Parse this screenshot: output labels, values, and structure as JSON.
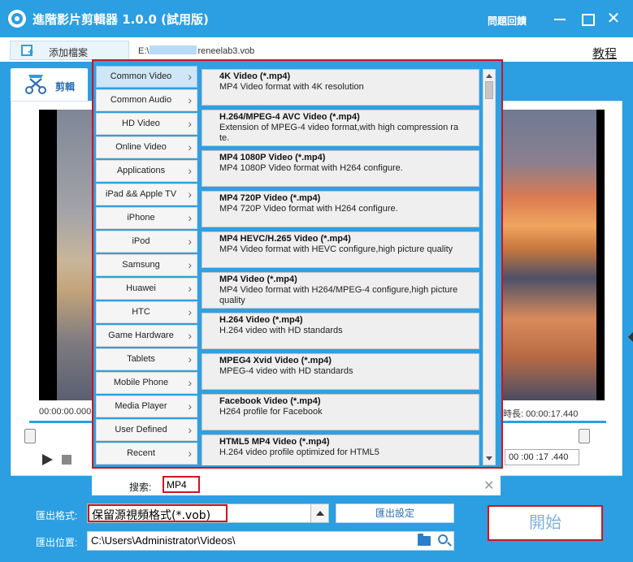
{
  "app": {
    "title": "進階影片剪輯器 1.0.0 (試用版)",
    "feedback": "問題回饋",
    "close_glyph": "✕"
  },
  "toolbar": {
    "add_file": "添加檔案",
    "file_path_prefix": "E:\\",
    "file_path_suffix": "reneelab3.vob",
    "tutorial": "教程"
  },
  "tabs": {
    "edit": "剪輯"
  },
  "player": {
    "start_time": "00:00:00.000",
    "duration": "時長:  00:00:17.440",
    "end_time": "00 :00 :17 .440"
  },
  "categories": [
    {
      "label": "Common Video",
      "active": true
    },
    {
      "label": "Common Audio"
    },
    {
      "label": "HD Video"
    },
    {
      "label": "Online Video"
    },
    {
      "label": "Applications"
    },
    {
      "label": "iPad && Apple TV"
    },
    {
      "label": "iPhone"
    },
    {
      "label": "iPod"
    },
    {
      "label": "Samsung"
    },
    {
      "label": "Huawei"
    },
    {
      "label": "HTC"
    },
    {
      "label": "Game Hardware"
    },
    {
      "label": "Tablets"
    },
    {
      "label": "Mobile Phone"
    },
    {
      "label": "Media Player"
    },
    {
      "label": "User Defined"
    },
    {
      "label": "Recent"
    }
  ],
  "formats": [
    {
      "name": "4K Video (*.mp4)",
      "desc": "MP4 Video format with 4K resolution"
    },
    {
      "name": "H.264/MPEG-4 AVC Video (*.mp4)",
      "desc": "Extension of MPEG-4 video format,with high compression rate."
    },
    {
      "name": "MP4 1080P Video (*.mp4)",
      "desc": "MP4 1080P Video format with H264 configure."
    },
    {
      "name": "MP4 720P Video (*.mp4)",
      "desc": "MP4 720P Video format with H264 configure."
    },
    {
      "name": "MP4 HEVC/H.265 Video (*.mp4)",
      "desc": "MP4 Video format with HEVC configure,high picture quality"
    },
    {
      "name": "MP4 Video (*.mp4)",
      "desc": "MP4 Video format with H264/MPEG-4 configure,high picture quality"
    },
    {
      "name": "H.264 Video (*.mp4)",
      "desc": "H.264 video with HD standards"
    },
    {
      "name": "MPEG4 Xvid Video (*.mp4)",
      "desc": "MPEG-4 video with HD standards"
    },
    {
      "name": "Facebook Video (*.mp4)",
      "desc": "H264 profile for Facebook"
    },
    {
      "name": "HTML5 MP4 Video (*.mp4)",
      "desc": "H.264 video profile optimized for HTML5"
    }
  ],
  "search": {
    "label": "搜索:",
    "value": "MP4",
    "clear_glyph": "✕"
  },
  "output": {
    "format_label": "匯出格式:",
    "format_value": "保留源視頻格式(*.vob)",
    "settings_button": "匯出設定",
    "location_label": "匯出位置:",
    "location_value": "C:\\Users\\Administrator\\Videos\\",
    "start_button": "開始"
  }
}
